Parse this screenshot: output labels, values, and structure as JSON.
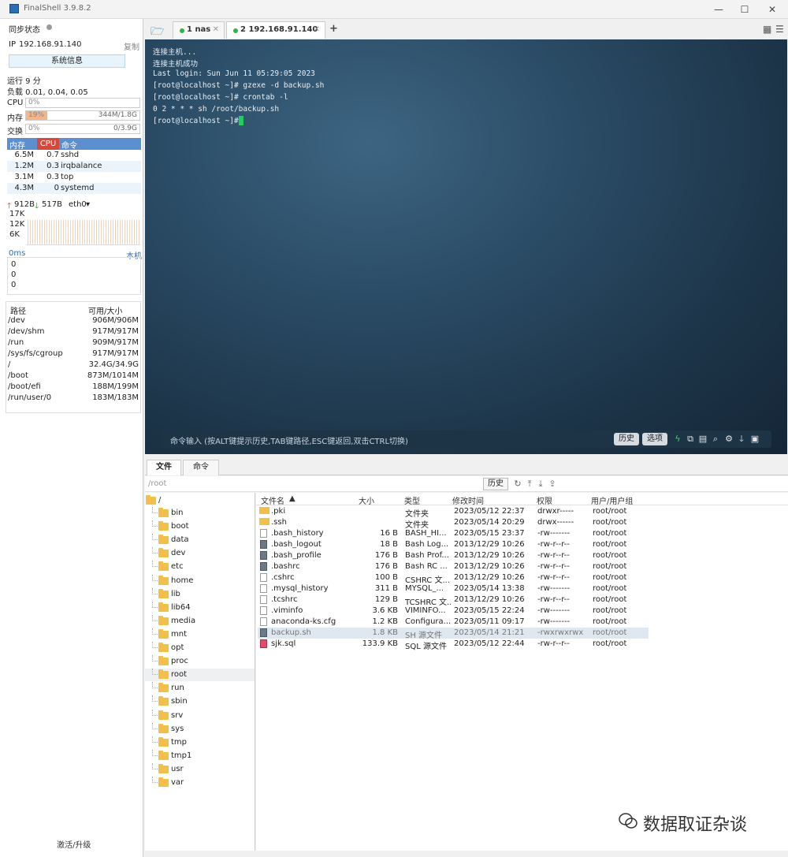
{
  "window": {
    "title": "FinalShell 3.9.8.2"
  },
  "left": {
    "sync_status": "同步状态",
    "ip_label": "IP",
    "ip": "192.168.91.140",
    "copy": "复制",
    "sysinfo_button": "系统信息",
    "uptime": "运行 9 分",
    "load": "负载 0.01, 0.04, 0.05",
    "cpu": {
      "label": "CPU",
      "pct_text": "0%",
      "fraction": 0.0
    },
    "mem": {
      "label": "内存",
      "pct_text": "19%",
      "fraction": 0.19,
      "detail": "344M/1.8G"
    },
    "swap": {
      "label": "交换",
      "pct_text": "0%",
      "fraction": 0.0,
      "detail": "0/3.9G"
    },
    "proc_headers": [
      "内存",
      "CPU",
      "命令"
    ],
    "processes": [
      {
        "mem": "6.5M",
        "cpu": "0.7",
        "cmd": "sshd"
      },
      {
        "mem": "1.2M",
        "cpu": "0.3",
        "cmd": "irqbalance"
      },
      {
        "mem": "3.1M",
        "cpu": "0.3",
        "cmd": "top"
      },
      {
        "mem": "4.3M",
        "cpu": "0",
        "cmd": "systemd"
      }
    ],
    "net": {
      "up": "912B",
      "down": "517B",
      "iface": "eth0",
      "ticks": [
        "17K",
        "12K",
        "6K"
      ]
    },
    "ping": {
      "label": "0ms",
      "host": "本机",
      "ticks": [
        "0",
        "0",
        "0"
      ]
    },
    "disk_headers": [
      "路径",
      "可用/大小"
    ],
    "disks": [
      {
        "path": "/dev",
        "size": "906M/906M"
      },
      {
        "path": "/dev/shm",
        "size": "917M/917M"
      },
      {
        "path": "/run",
        "size": "909M/917M"
      },
      {
        "path": "/sys/fs/cgroup",
        "size": "917M/917M"
      },
      {
        "path": "/",
        "size": "32.4G/34.9G"
      },
      {
        "path": "/boot",
        "size": "873M/1014M"
      },
      {
        "path": "/boot/efi",
        "size": "188M/199M"
      },
      {
        "path": "/run/user/0",
        "size": "183M/183M"
      }
    ],
    "upgrade": "激活/升级"
  },
  "tabs": [
    {
      "label": "1 nas"
    },
    {
      "label": "2 192.168.91.140"
    }
  ],
  "add_tab": "+",
  "terminal": {
    "lines": [
      "连接主机...",
      "连接主机成功",
      "Last login: Sun Jun 11 05:29:05 2023",
      "[root@localhost ~]# gzexe -d backup.sh",
      "[root@localhost ~]# crontab -l",
      "0 2 * * * sh /root/backup.sh",
      "[root@localhost ~]# "
    ],
    "cmd_hint": "命令输入 (按ALT键提示历史,TAB键路径,ESC键返回,双击CTRL切换)",
    "history_button": "历史",
    "options_button": "选项"
  },
  "bottom_tabs": [
    "文件",
    "命令"
  ],
  "path": "/root",
  "history": "历史",
  "tree": {
    "root": "/",
    "dirs": [
      "bin",
      "boot",
      "data",
      "dev",
      "etc",
      "home",
      "lib",
      "lib64",
      "media",
      "mnt",
      "opt",
      "proc",
      "root",
      "run",
      "sbin",
      "srv",
      "sys",
      "tmp",
      "tmp1",
      "usr",
      "var"
    ],
    "selected": "root"
  },
  "file_headers": [
    "文件名",
    "大小",
    "类型",
    "修改时间",
    "权限",
    "用户/用户组"
  ],
  "files": [
    {
      "name": ".pki",
      "size": "",
      "type": "文件夹",
      "mtime": "2023/05/12 22:37",
      "perm": "drwxr-----",
      "owner": "root/root",
      "icon": "folder"
    },
    {
      "name": ".ssh",
      "size": "",
      "type": "文件夹",
      "mtime": "2023/05/14 20:29",
      "perm": "drwx------",
      "owner": "root/root",
      "icon": "folder"
    },
    {
      "name": ".bash_history",
      "size": "16 B",
      "type": "BASH_HI...",
      "mtime": "2023/05/15 23:37",
      "perm": "-rw-------",
      "owner": "root/root",
      "icon": "doc"
    },
    {
      "name": ".bash_logout",
      "size": "18 B",
      "type": "Bash Log...",
      "mtime": "2013/12/29 10:26",
      "perm": "-rw-r--r--",
      "owner": "root/root",
      "icon": "bin"
    },
    {
      "name": ".bash_profile",
      "size": "176 B",
      "type": "Bash Prof...",
      "mtime": "2013/12/29 10:26",
      "perm": "-rw-r--r--",
      "owner": "root/root",
      "icon": "bin"
    },
    {
      "name": ".bashrc",
      "size": "176 B",
      "type": "Bash RC ...",
      "mtime": "2013/12/29 10:26",
      "perm": "-rw-r--r--",
      "owner": "root/root",
      "icon": "bin"
    },
    {
      "name": ".cshrc",
      "size": "100 B",
      "type": "CSHRC 文...",
      "mtime": "2013/12/29 10:26",
      "perm": "-rw-r--r--",
      "owner": "root/root",
      "icon": "doc"
    },
    {
      "name": ".mysql_history",
      "size": "311 B",
      "type": "MYSQL_...",
      "mtime": "2023/05/14 13:38",
      "perm": "-rw-------",
      "owner": "root/root",
      "icon": "doc"
    },
    {
      "name": ".tcshrc",
      "size": "129 B",
      "type": "TCSHRC 文...",
      "mtime": "2013/12/29 10:26",
      "perm": "-rw-r--r--",
      "owner": "root/root",
      "icon": "doc"
    },
    {
      "name": ".viminfo",
      "size": "3.6 KB",
      "type": "VIMINFO...",
      "mtime": "2023/05/15 22:24",
      "perm": "-rw-------",
      "owner": "root/root",
      "icon": "doc"
    },
    {
      "name": "anaconda-ks.cfg",
      "size": "1.2 KB",
      "type": "Configura...",
      "mtime": "2023/05/11 09:17",
      "perm": "-rw-------",
      "owner": "root/root",
      "icon": "cfg"
    },
    {
      "name": "backup.sh",
      "size": "1.8 KB",
      "type": "SH 源文件",
      "mtime": "2023/05/14 21:21",
      "perm": "-rwxrwxrwx",
      "owner": "root/root",
      "icon": "bin"
    },
    {
      "name": "sjk.sql",
      "size": "133.9 KB",
      "type": "SQL 源文件",
      "mtime": "2023/05/12 22:44",
      "perm": "-rw-r--r--",
      "owner": "root/root",
      "icon": "sql"
    }
  ],
  "selected_file": "backup.sh",
  "watermark": "数据取证杂谈"
}
